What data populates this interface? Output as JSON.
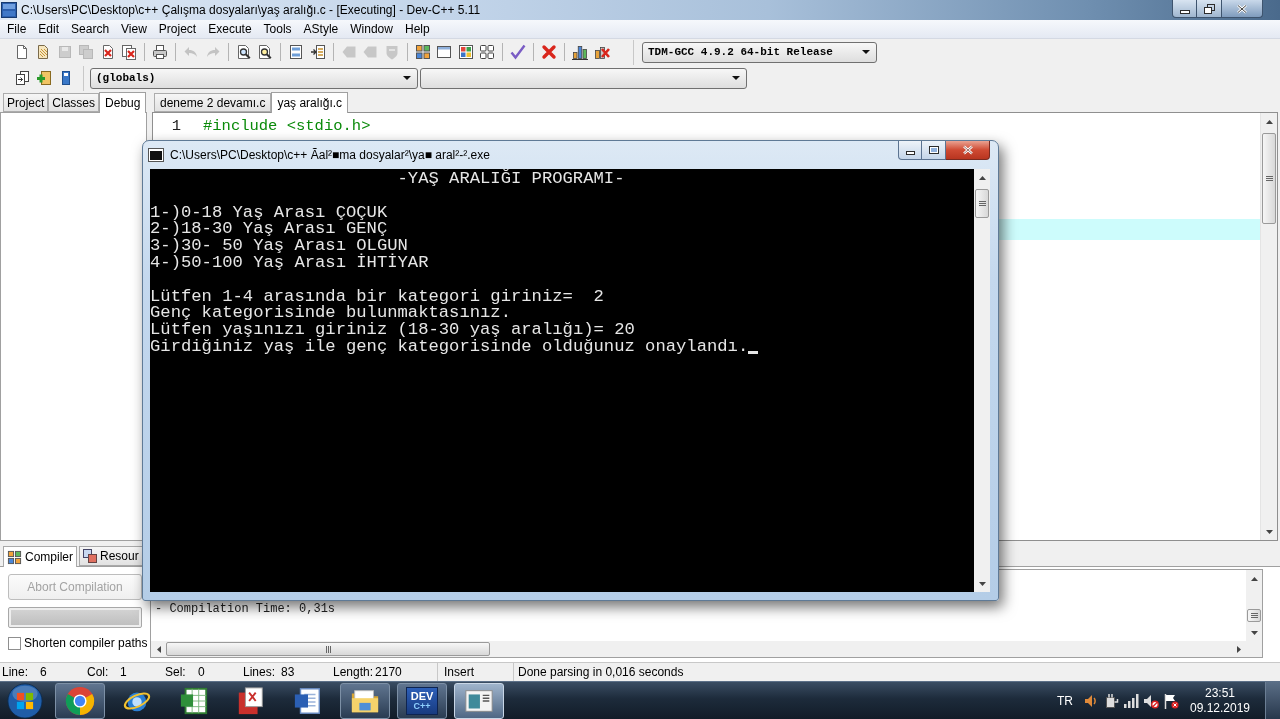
{
  "window": {
    "title": "C:\\Users\\PC\\Desktop\\c++ Çalışma dosyaları\\yaş aralığı.c - [Executing] - Dev-C++ 5.11"
  },
  "menu": [
    "File",
    "Edit",
    "Search",
    "View",
    "Project",
    "Execute",
    "Tools",
    "AStyle",
    "Window",
    "Help"
  ],
  "toolbar": {
    "groups": [
      [
        {
          "kind": "new",
          "disabled": false
        },
        {
          "kind": "open",
          "disabled": false
        },
        {
          "kind": "save",
          "disabled": true
        },
        {
          "kind": "save_all",
          "disabled": true
        },
        {
          "kind": "close",
          "disabled": false
        },
        {
          "kind": "close_all",
          "disabled": false
        }
      ],
      [
        {
          "kind": "print",
          "disabled": false
        }
      ],
      [
        {
          "kind": "undo",
          "disabled": true
        },
        {
          "kind": "redo",
          "disabled": true
        }
      ],
      [
        {
          "kind": "find",
          "disabled": false
        },
        {
          "kind": "replace",
          "disabled": false
        }
      ],
      [
        {
          "kind": "indent",
          "disabled": false
        },
        {
          "kind": "unindent",
          "disabled": false
        }
      ],
      [
        {
          "kind": "back",
          "disabled": true
        },
        {
          "kind": "forward",
          "disabled": true
        },
        {
          "kind": "bookmark",
          "disabled": true
        }
      ],
      [
        {
          "kind": "compile",
          "disabled": false
        },
        {
          "kind": "run",
          "disabled": false
        },
        {
          "kind": "compile_run",
          "disabled": false
        },
        {
          "kind": "rebuild",
          "disabled": false
        }
      ],
      [
        {
          "kind": "check",
          "disabled": false
        }
      ],
      [
        {
          "kind": "stop",
          "disabled": false
        }
      ],
      [
        {
          "kind": "profile",
          "disabled": false
        },
        {
          "kind": "delete_profile",
          "disabled": false
        }
      ]
    ],
    "compiler": "TDM-GCC 4.9.2 64-bit Release"
  },
  "toolbar_2": {
    "buttons": [
      {
        "kind": "project"
      },
      {
        "kind": "add"
      },
      {
        "kind": "class"
      }
    ],
    "scope": "(globals)"
  },
  "side_panel": {
    "tabs": [
      {
        "label": "Project",
        "selected": false
      },
      {
        "label": "Classes",
        "selected": false
      },
      {
        "label": "Debug",
        "selected": true
      }
    ]
  },
  "editor": {
    "tabs": [
      {
        "label": "deneme 2 devamı.c",
        "selected": false
      },
      {
        "label": "yaş aralığı.c",
        "selected": true
      }
    ],
    "lines": [
      {
        "number": "1",
        "code": "#include <stdio.h>"
      }
    ],
    "current_line_highlight": true
  },
  "console": {
    "title": "C:\\Users\\PC\\Desktop\\c++ Ãal²■ma dosyalar²\\ya■ aral²-².exe",
    "heading": "-YAŞ ARALIĞI PROGRAMI-",
    "menu_lines": [
      "1-)0-18 Yaş Arası ÇOÇUK",
      "2-)18-30 Yaş Arası GENÇ",
      "3-)30- 50 Yaş Arası OLGUN",
      "4-)50-100 Yaş Arası İHTİYAR"
    ],
    "session_lines": [
      "Lütfen 1-4 arasında bir kategori giriniz=  2",
      "Genç kategorisinde bulunmaktasınız.",
      "Lütfen yaşınızı giriniz (18-30 yaş aralığı)= 20",
      "Girdiğiniz yaş ile genç kategorisinde olduğunuz onaylandı."
    ],
    "cursor": true
  },
  "bottom_panel": {
    "tabs": [
      {
        "label": "Compiler",
        "kind": "compiler",
        "selected": true
      },
      {
        "label": "Resour",
        "kind": "resources",
        "selected": false
      }
    ],
    "abort_button": {
      "label": "Abort Compilation",
      "disabled": true
    },
    "progress": {
      "level": 1
    },
    "shorten_paths": {
      "label": "Shorten compiler paths",
      "checked": false
    },
    "log": [
      "- Compilation Time: 0,31s"
    ]
  },
  "status_bar": {
    "fields": [
      {
        "label": "Line:",
        "value": "6"
      },
      {
        "label": "Col:",
        "value": "1"
      },
      {
        "label": "Sel:",
        "value": "0"
      },
      {
        "label": "Lines:",
        "value": "83"
      },
      {
        "label": "Length:",
        "value": "2170"
      }
    ],
    "mode": "Insert",
    "message": "Done parsing in 0,016 seconds"
  },
  "taskbar": {
    "apps": [
      {
        "kind": "wheel",
        "running": true,
        "selected": false
      },
      {
        "kind": "globe",
        "running": false,
        "selected": false
      },
      {
        "kind": "spreadsheet",
        "running": false,
        "selected": false
      },
      {
        "kind": "pdf",
        "running": false,
        "selected": false
      },
      {
        "kind": "word_processor",
        "running": false,
        "selected": false
      },
      {
        "kind": "folder",
        "running": true,
        "selected": false
      },
      {
        "kind": "ide",
        "text": "DEV",
        "subtext": "C++",
        "running": true,
        "selected": false
      },
      {
        "kind": "window",
        "running": true,
        "selected": true
      }
    ],
    "tray": {
      "language": "TR",
      "time": "23:51",
      "date": "09.12.2019"
    }
  }
}
